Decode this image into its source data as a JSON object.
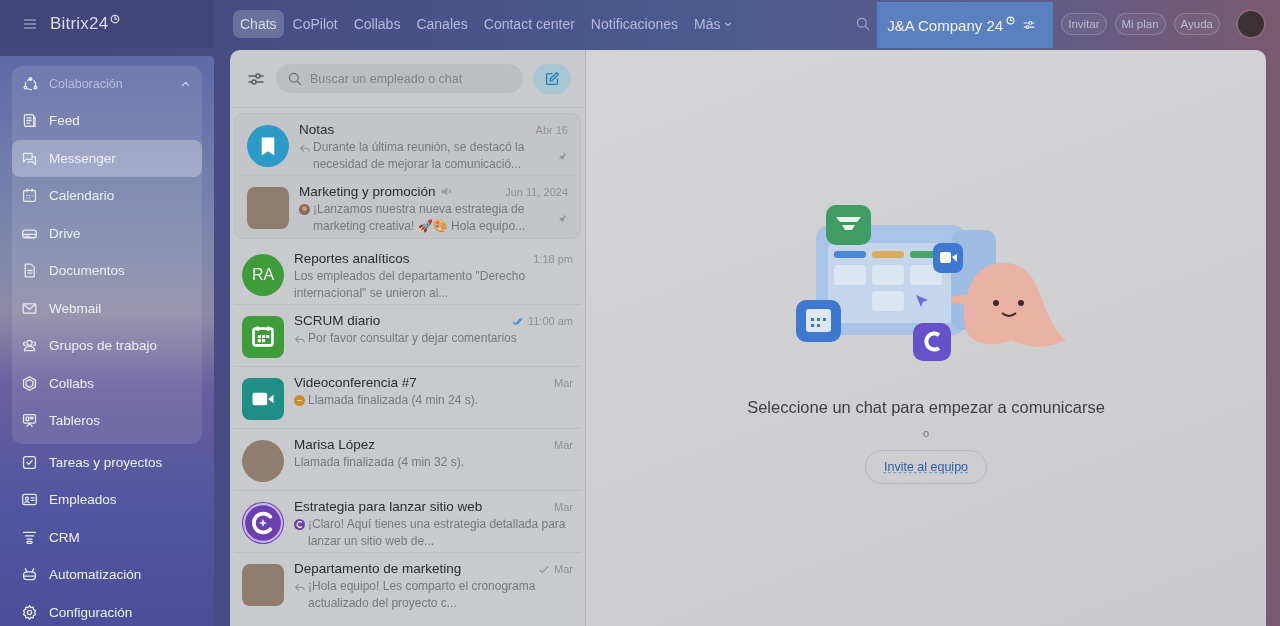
{
  "header": {
    "logo": "Bitrix24",
    "tabs": [
      {
        "label": "Chats",
        "selected": true,
        "dropdown": false
      },
      {
        "label": "CoPilot",
        "selected": false,
        "dropdown": false
      },
      {
        "label": "Collabs",
        "selected": false,
        "dropdown": false
      },
      {
        "label": "Canales",
        "selected": false,
        "dropdown": false
      },
      {
        "label": "Contact center",
        "selected": false,
        "dropdown": false
      },
      {
        "label": "Notificaciones",
        "selected": false,
        "dropdown": false
      },
      {
        "label": "Más",
        "selected": false,
        "dropdown": true
      }
    ],
    "company": "J&A Company 24",
    "buttons": [
      "Invitar",
      "Mi plan",
      "Ayuda"
    ]
  },
  "sidebar": {
    "group": {
      "title": "Colaboración",
      "expanded": true,
      "items": [
        {
          "label": "Feed",
          "selected": false
        },
        {
          "label": "Messenger",
          "selected": true
        },
        {
          "label": "Calendario",
          "selected": false
        },
        {
          "label": "Drive",
          "selected": false
        },
        {
          "label": "Documentos",
          "selected": false
        },
        {
          "label": "Webmail",
          "selected": false
        },
        {
          "label": "Grupos de trabajo",
          "selected": false
        },
        {
          "label": "Collabs",
          "selected": false
        },
        {
          "label": "Tableros",
          "selected": false
        }
      ]
    },
    "items": [
      {
        "label": "Tareas y proyectos",
        "selected": false
      },
      {
        "label": "Empleados",
        "selected": false
      },
      {
        "label": "CRM",
        "selected": false
      },
      {
        "label": "Automatización",
        "selected": false
      },
      {
        "label": "Configuración",
        "selected": false
      }
    ]
  },
  "chat_list": {
    "search": {
      "placeholder": "Buscar un empleado o chat"
    },
    "pinned": [
      {
        "name": "Notas",
        "time": "Abr 16",
        "preview": "Durante la última reunión, se destacó la necesidad de mejorar la comunicació...",
        "avatar": {
          "kind": "bookmark",
          "color": "#2b9ac9"
        },
        "prefix": {
          "kind": "reply"
        },
        "muted": false,
        "pinned": true
      },
      {
        "name": "Marketing y promoción",
        "time": "Jun 11, 2024",
        "preview": "¡Lanzamos nuestra nueva estrategia de marketing creativa! 🚀🎨 Hola equipo...",
        "avatar": {
          "kind": "photo",
          "round": false
        },
        "prefix": {
          "kind": "avatar"
        },
        "muted": true,
        "pinned": true
      }
    ],
    "recent": [
      {
        "name": "Reportes analíticos",
        "time": "1:18 pm",
        "preview": "Los empleados del departamento \"Derecho internacional\" se unieron al...",
        "avatar": {
          "kind": "initials",
          "text": "RA",
          "color": "#3f9c3a"
        },
        "muted": false,
        "pinned": false
      },
      {
        "name": "SCRUM diario",
        "time": "11:00 am",
        "preview": "Por favor consultar y dejar comentarios",
        "avatar": {
          "kind": "calendar",
          "color": "#3f9c3a"
        },
        "prefix": {
          "kind": "reply"
        },
        "status": {
          "kind": "read"
        },
        "muted": false,
        "pinned": false
      },
      {
        "name": "Videoconferencia #7",
        "time": "Mar",
        "preview": "Llamada finalizada (4 min 24 s).",
        "avatar": {
          "kind": "video",
          "color": "#1f8f86"
        },
        "prefix": {
          "kind": "call"
        },
        "muted": false,
        "pinned": false
      },
      {
        "name": "Marisa López",
        "time": "Mar",
        "preview": "Llamada finalizada (4 min 32 s).",
        "avatar": {
          "kind": "photo",
          "round": true
        },
        "muted": false,
        "pinned": false
      },
      {
        "name": "Estrategia para lanzar sitio web",
        "time": "Mar",
        "preview": "¡Claro! Aquí tienes una estrategia detallada para lanzar un sitio web de...",
        "avatar": {
          "kind": "copilot",
          "color": "#6a3fb0"
        },
        "prefix": {
          "kind": "copilot"
        },
        "muted": false,
        "pinned": false
      },
      {
        "name": "Departamento de marketing",
        "time": "Mar",
        "preview": "¡Hola equipo! Les comparto el cronograma actualizado del proyecto c...",
        "avatar": {
          "kind": "photo",
          "round": false
        },
        "prefix": {
          "kind": "reply"
        },
        "status": {
          "kind": "delivered"
        },
        "muted": false,
        "pinned": false
      }
    ]
  },
  "main": {
    "message": "Seleccione un chat para empezar a comunicarse",
    "separator": "o",
    "button": "Invite al equipo"
  }
}
